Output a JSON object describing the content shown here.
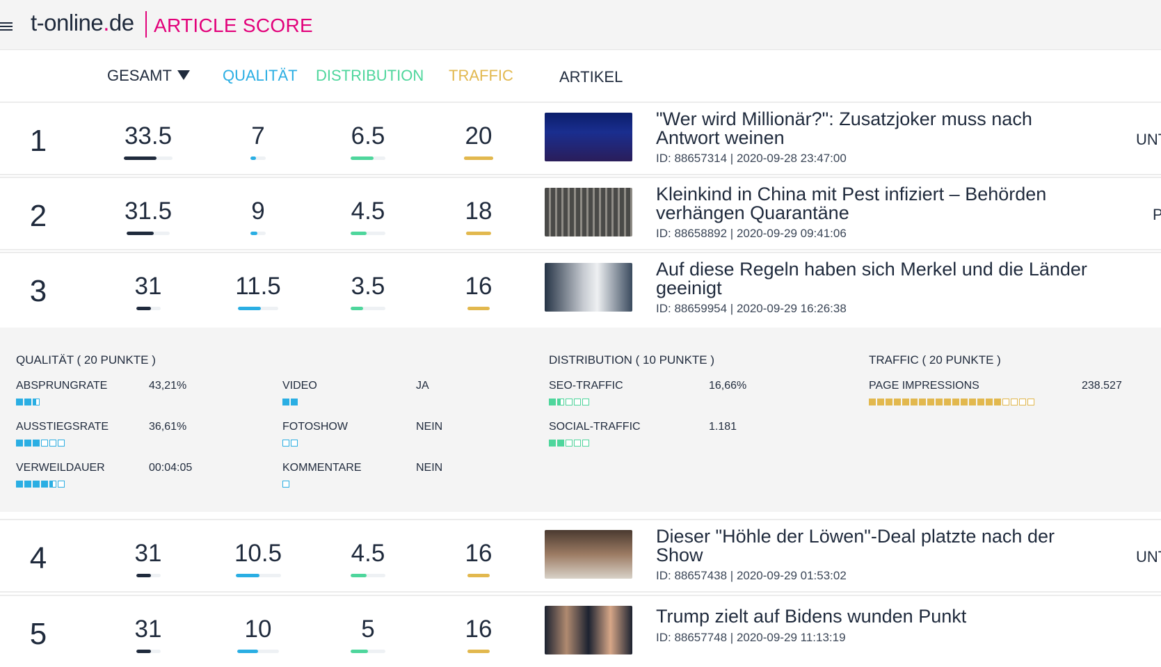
{
  "header": {
    "logo_main": "t-online",
    "logo_dot": ".",
    "logo_tld": "de",
    "app_title": "ARTICLE SCORE"
  },
  "columns": {
    "gesamt": "GESAMT",
    "qualitaet": "QUALITÄT",
    "distribution": "DISTRIBUTION",
    "traffic": "TRAFFIC",
    "artikel": "ARTIKEL"
  },
  "colors": {
    "brand": "#e2007a",
    "qualitaet": "#2aaee3",
    "distribution": "#4ed69c",
    "traffic": "#e2b84e",
    "gesamt": "#1f2a3c"
  },
  "rows": [
    {
      "rank": "1",
      "gesamt": "33.5",
      "qualitaet": "7",
      "distribution": "6.5",
      "traffic": "20",
      "title": "\"Wer wird Millionär?\": Zusatzjoker muss nach Antwort weinen",
      "meta": "ID: 88657314 | 2020-09-28 23:47:00",
      "edge_text": "UNT",
      "levels": {
        "gesamt": 0.67,
        "qualitaet": 0.35,
        "distribution": 0.65,
        "traffic": 1.0
      }
    },
    {
      "rank": "2",
      "gesamt": "31.5",
      "qualitaet": "9",
      "distribution": "4.5",
      "traffic": "18",
      "title": "Kleinkind in China mit Pest infiziert – Behörden verhängen Quarantäne",
      "meta": "ID: 88658892 | 2020-09-29 09:41:06",
      "edge_text": "P",
      "levels": {
        "gesamt": 0.63,
        "qualitaet": 0.45,
        "distribution": 0.45,
        "traffic": 0.9
      }
    },
    {
      "rank": "3",
      "gesamt": "31",
      "qualitaet": "11.5",
      "distribution": "3.5",
      "traffic": "16",
      "title": "Auf diese Regeln haben sich Merkel und die Länder geeinigt",
      "meta": "ID: 88659954 | 2020-09-29 16:26:38",
      "edge_text": "",
      "levels": {
        "gesamt": 0.62,
        "qualitaet": 0.575,
        "distribution": 0.35,
        "traffic": 0.8
      }
    },
    {
      "rank": "4",
      "gesamt": "31",
      "qualitaet": "10.5",
      "distribution": "4.5",
      "traffic": "16",
      "title": "Dieser \"Höhle der Löwen\"-Deal platzte nach der Show",
      "meta": "ID: 88657438 | 2020-09-29 01:53:02",
      "edge_text": "UNT",
      "levels": {
        "gesamt": 0.62,
        "qualitaet": 0.525,
        "distribution": 0.45,
        "traffic": 0.8
      }
    },
    {
      "rank": "5",
      "gesamt": "31",
      "qualitaet": "10",
      "distribution": "5",
      "traffic": "16",
      "title": "Trump zielt auf Bidens wunden Punkt",
      "meta": "ID: 88657748 | 2020-09-29 11:13:19",
      "edge_text": "",
      "levels": {
        "gesamt": 0.62,
        "qualitaet": 0.5,
        "distribution": 0.5,
        "traffic": 0.8
      }
    }
  ],
  "detail": {
    "qualitaet": {
      "heading": "QUALITÄT ( 20 PUNKTE )",
      "items": [
        {
          "label": "ABSPRUNGRATE",
          "value": "43,21%",
          "filled": 2.5,
          "total": 3
        },
        {
          "label": "AUSSTIEGSRATE",
          "value": "36,61%",
          "filled": 3,
          "total": 6
        },
        {
          "label": "VERWEILDAUER",
          "value": "00:04:05",
          "filled": 4.5,
          "total": 6
        },
        {
          "label": "VIDEO",
          "value": "JA",
          "filled": 2,
          "total": 2
        },
        {
          "label": "FOTOSHOW",
          "value": "NEIN",
          "filled": 0,
          "total": 2
        },
        {
          "label": "KOMMENTARE",
          "value": "NEIN",
          "filled": 0,
          "total": 1
        }
      ]
    },
    "distribution": {
      "heading": "DISTRIBUTION ( 10 PUNKTE )",
      "items": [
        {
          "label": "SEO-TRAFFIC",
          "value": "16,66%",
          "filled": 1.5,
          "total": 5
        },
        {
          "label": "SOCIAL-TRAFFIC",
          "value": "1.181",
          "filled": 2,
          "total": 5
        }
      ]
    },
    "traffic": {
      "heading": "TRAFFIC ( 20 PUNKTE )",
      "items": [
        {
          "label": "PAGE IMPRESSIONS",
          "value": "238.527",
          "filled": 16,
          "total": 20
        }
      ]
    }
  },
  "icons": {
    "menu": "hamburger-menu-icon",
    "sort": "sort-desc-triangle-icon"
  }
}
